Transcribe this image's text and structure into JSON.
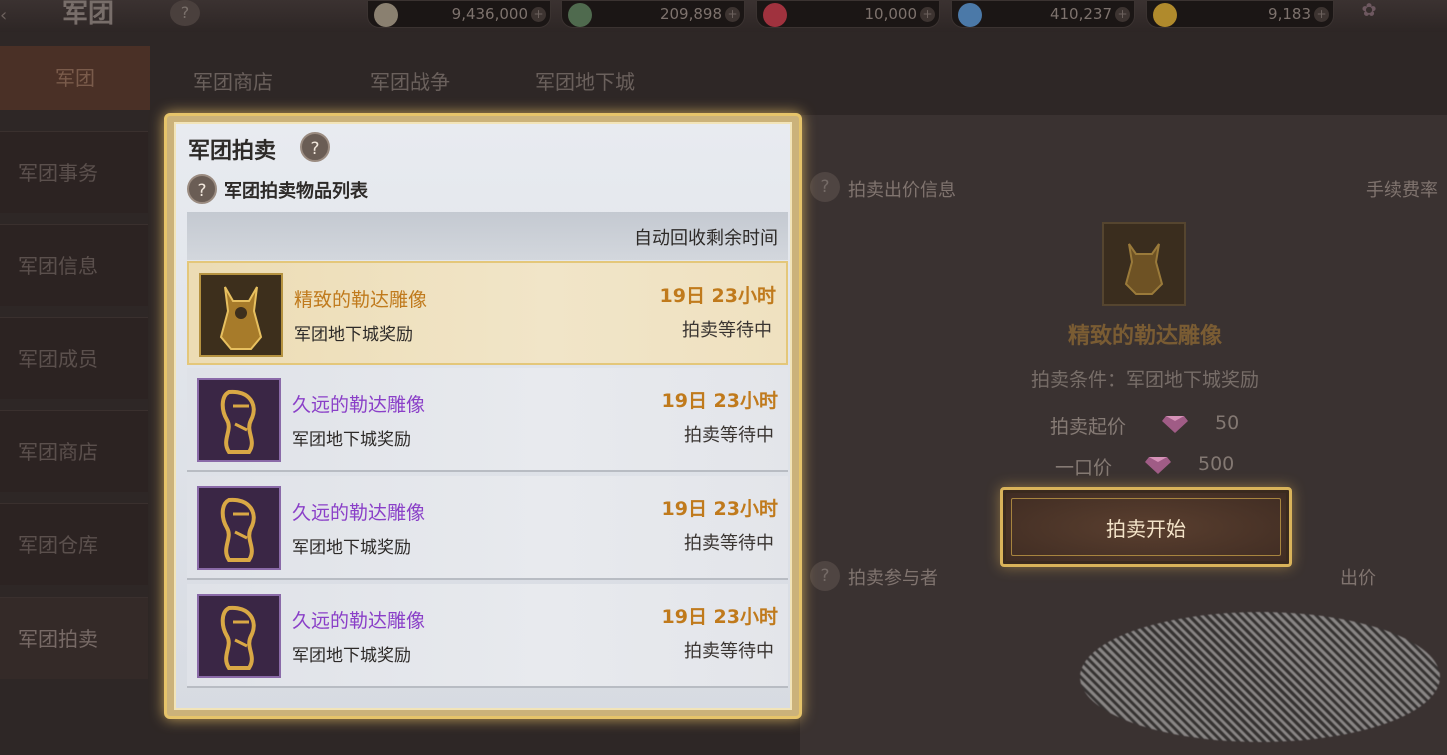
{
  "topbar": {
    "title": "军团",
    "help": "?",
    "currencies": [
      {
        "icon": "silver-coin-icon",
        "value": "9,436,000",
        "color": "#8a8070"
      },
      {
        "icon": "green-coin-icon",
        "value": "209,898",
        "color": "#4f6a4e"
      },
      {
        "icon": "red-gem-icon",
        "value": "10,000",
        "color": "#a0323e"
      },
      {
        "icon": "blue-crystal-icon",
        "value": "410,237",
        "color": "#4b79a8"
      },
      {
        "icon": "gold-coin-icon",
        "value": "9,183",
        "color": "#b08a2c"
      }
    ],
    "plus": "+"
  },
  "nav": {
    "main": "军团",
    "items": [
      {
        "label": "军团事务"
      },
      {
        "label": "军团信息"
      },
      {
        "label": "军团成员"
      },
      {
        "label": "军团商店"
      },
      {
        "label": "军团仓库"
      },
      {
        "label": "军团拍卖"
      }
    ]
  },
  "tabs": [
    "军团商店",
    "军团战争",
    "军团地下城"
  ],
  "right": {
    "bid_info_label": "拍卖出价信息",
    "fee_label": "手续费率",
    "item_name": "精致的勒达雕像",
    "condition": "拍卖条件：军团地下城奖励",
    "start_price_label": "拍卖起价",
    "start_price": "50",
    "buyout_label": "一口价",
    "buyout": "500",
    "start_button": "拍卖开始",
    "participants_label": "拍卖参与者",
    "bid_label": "出价"
  },
  "modal": {
    "title": "军团拍卖",
    "subtitle": "军团拍卖物品列表",
    "column_header": "自动回收剩余时间",
    "rows": [
      {
        "name": "精致的勒达雕像",
        "source": "军团地下城奖励",
        "time": "19日 23小时",
        "status": "拍卖等待中",
        "rarity": "gold"
      },
      {
        "name": "久远的勒达雕像",
        "source": "军团地下城奖励",
        "time": "19日 23小时",
        "status": "拍卖等待中",
        "rarity": "purple"
      },
      {
        "name": "久远的勒达雕像",
        "source": "军团地下城奖励",
        "time": "19日 23小时",
        "status": "拍卖等待中",
        "rarity": "purple"
      },
      {
        "name": "久远的勒达雕像",
        "source": "军团地下城奖励",
        "time": "19日 23小时",
        "status": "拍卖等待中",
        "rarity": "purple"
      }
    ]
  }
}
